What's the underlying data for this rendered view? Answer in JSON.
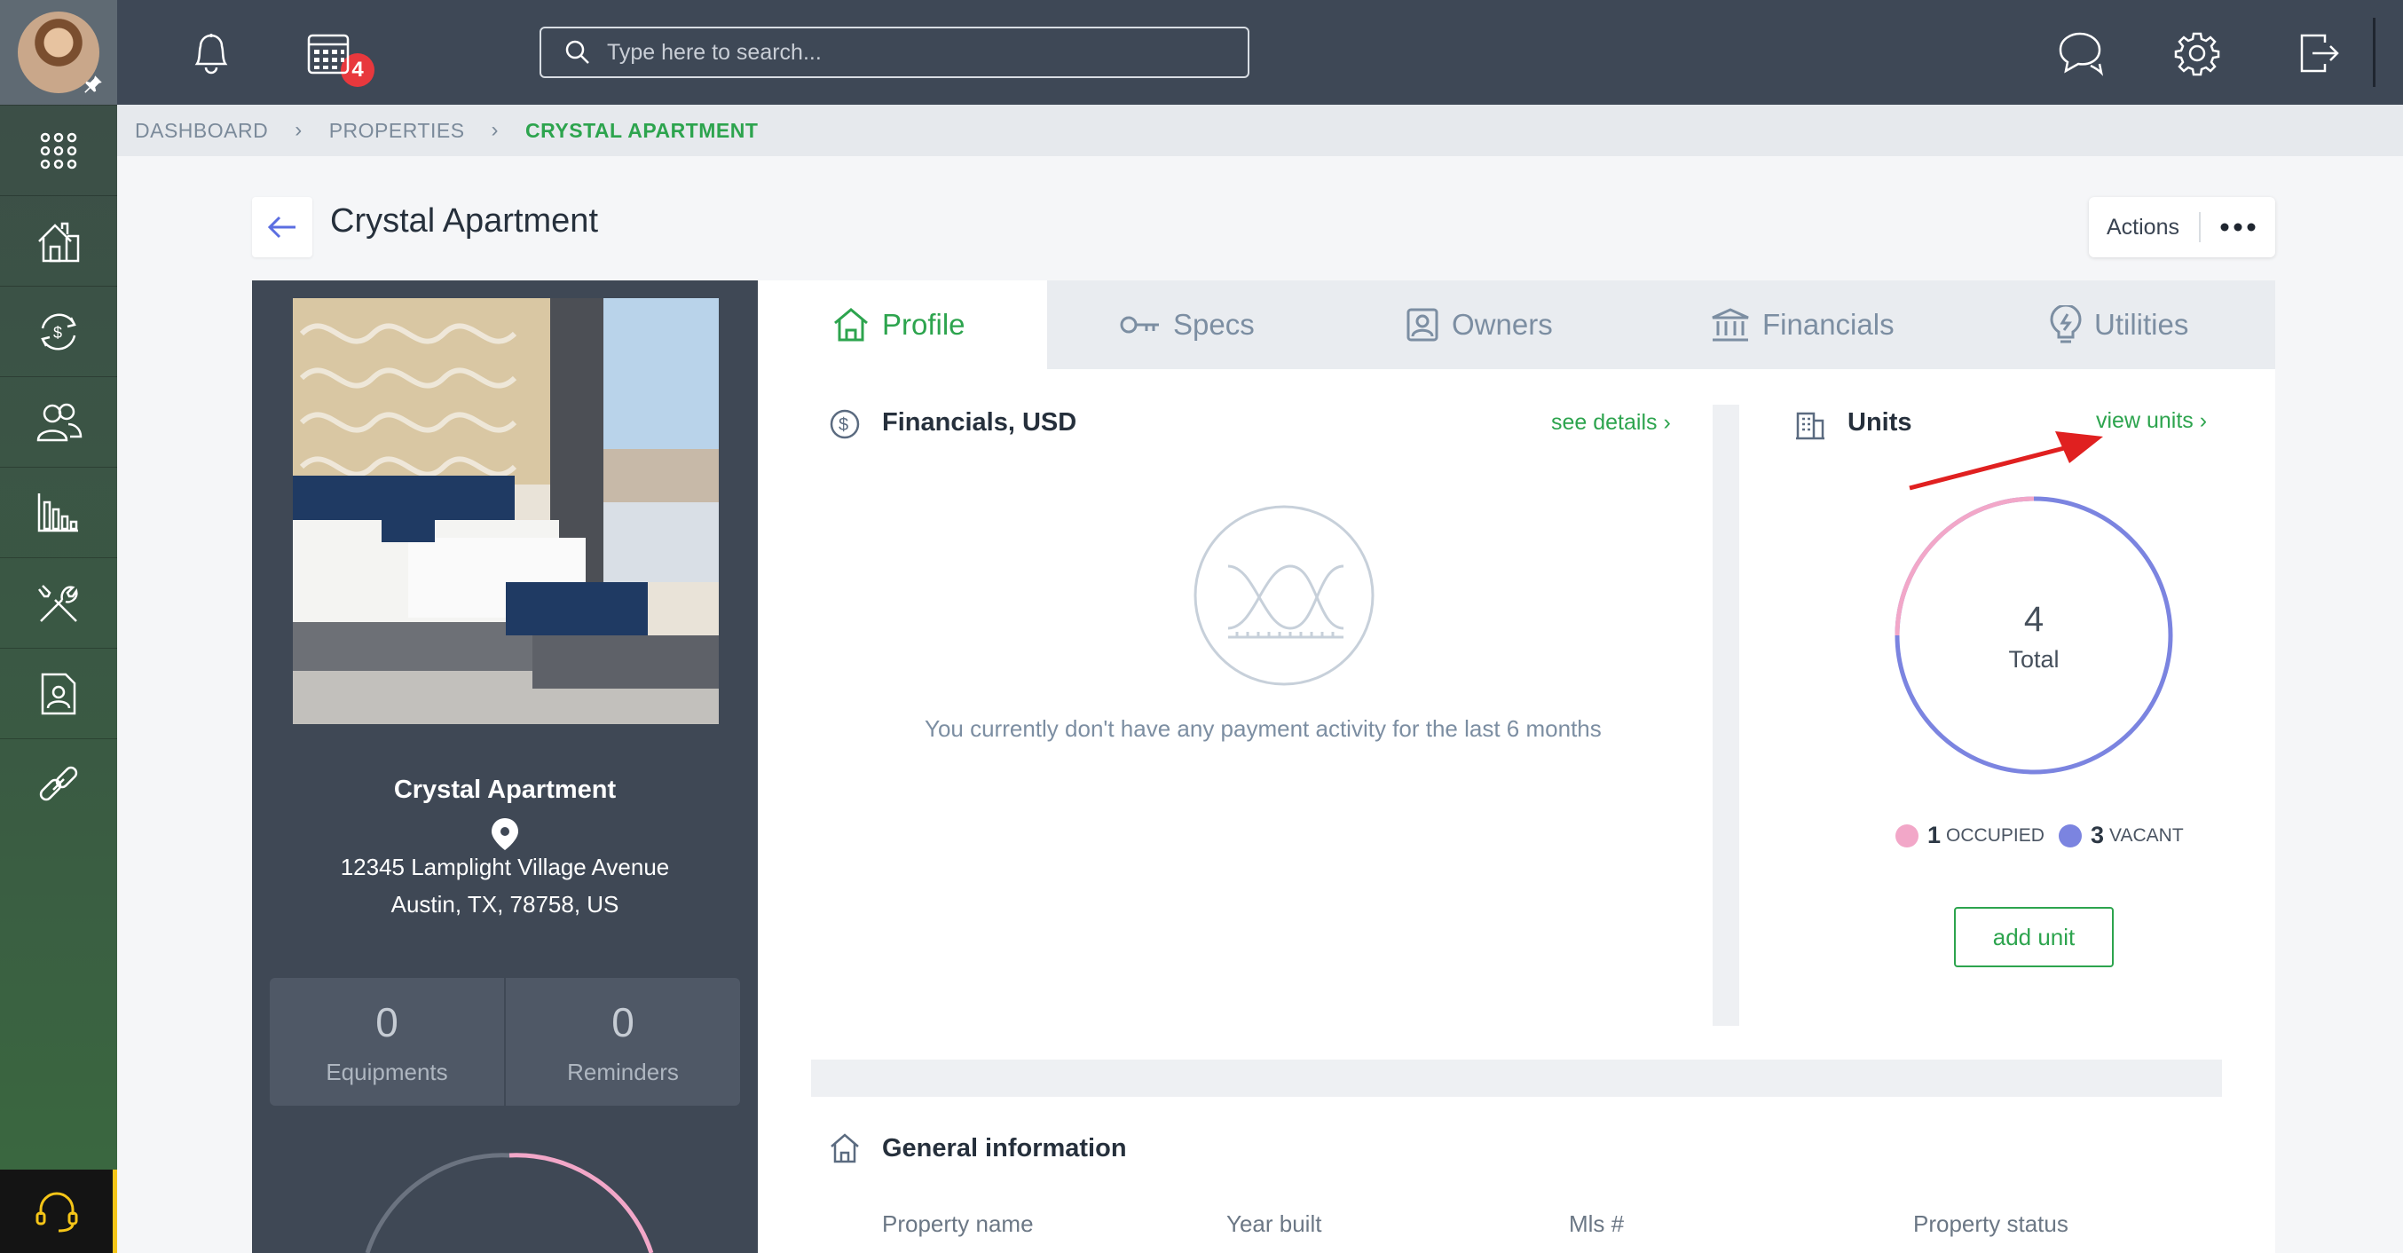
{
  "topbar": {
    "notifications_count": "4",
    "search_placeholder": "Type here to search..."
  },
  "breadcrumb": {
    "items": [
      "DASHBOARD",
      "PROPERTIES"
    ],
    "current": "CRYSTAL APARTMENT"
  },
  "page": {
    "title": "Crystal Apartment",
    "actions_label": "Actions"
  },
  "property": {
    "name": "Crystal Apartment",
    "address_line1": "12345 Lamplight Village Avenue",
    "address_line2": "Austin, TX, 78758, US",
    "stats": [
      {
        "value": "0",
        "label": "Equipments"
      },
      {
        "value": "0",
        "label": "Reminders"
      }
    ]
  },
  "tabs": [
    {
      "label": "Profile",
      "icon": "home-icon",
      "active": true
    },
    {
      "label": "Specs",
      "icon": "key-icon"
    },
    {
      "label": "Owners",
      "icon": "owner-card-icon"
    },
    {
      "label": "Financials",
      "icon": "bank-icon"
    },
    {
      "label": "Utilities",
      "icon": "bulb-icon"
    }
  ],
  "financials": {
    "title": "Financials, USD",
    "link": "see details",
    "empty_message": "You currently don't have any payment activity for the last 6 months"
  },
  "units": {
    "title": "Units",
    "link": "view units",
    "total": "4",
    "total_label": "Total",
    "occupied_count": "1",
    "occupied_label": "OCCUPIED",
    "vacant_count": "3",
    "vacant_label": "VACANT",
    "add_button": "add unit",
    "colors": {
      "occupied": "#f2a7c8",
      "vacant": "#7b84e0"
    }
  },
  "general": {
    "title": "General information",
    "columns": [
      "Property name",
      "Year built",
      "Mls #",
      "Property status"
    ]
  },
  "colors": {
    "accent": "#2da44e",
    "topbar": "#3e4856",
    "annotation_arrow": "#e02020"
  }
}
